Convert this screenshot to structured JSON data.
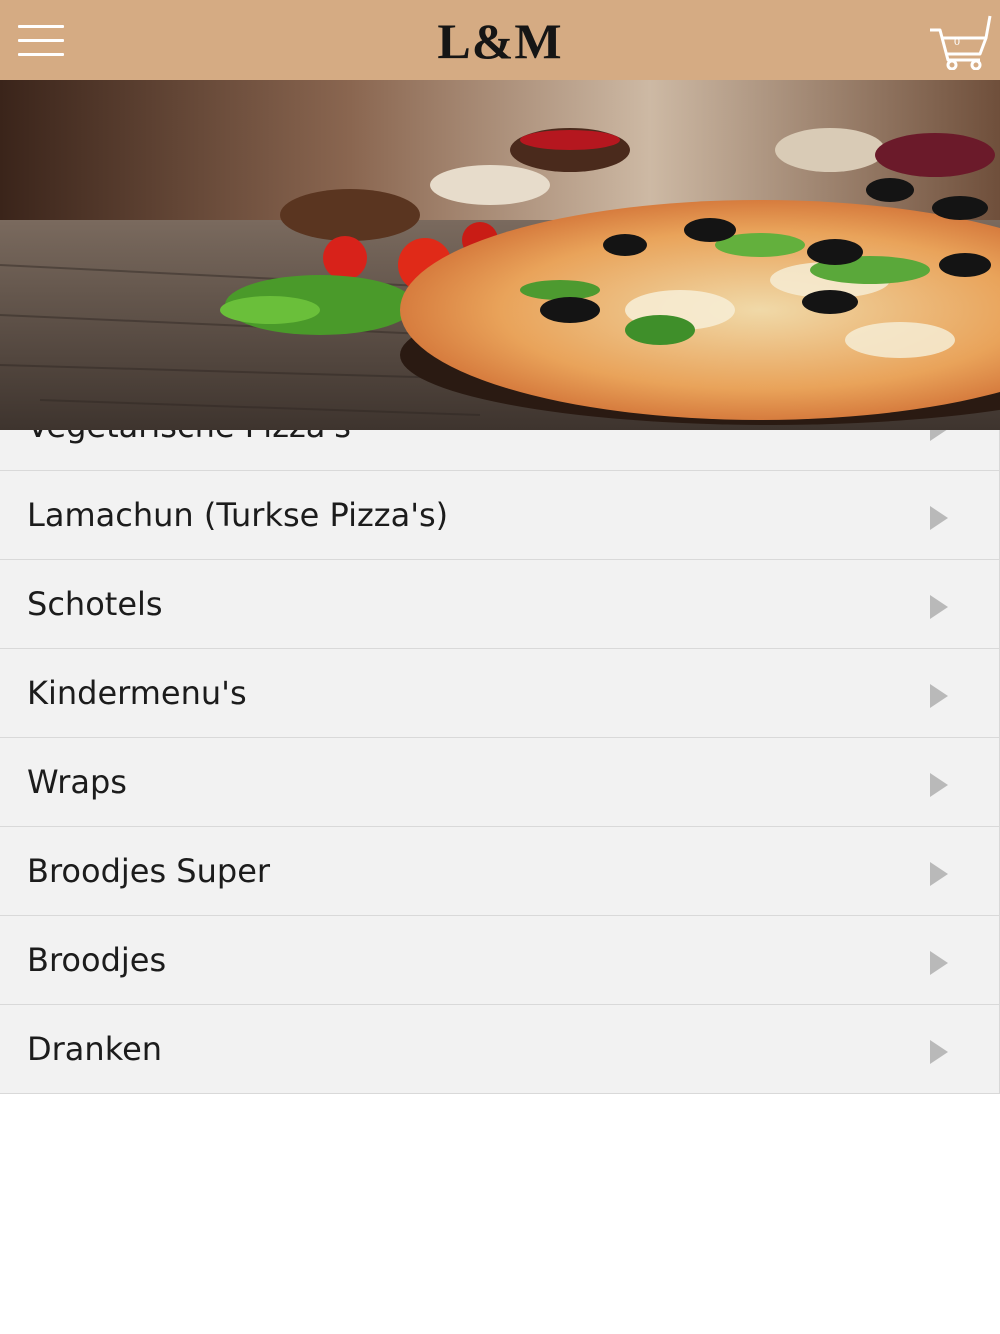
{
  "header": {
    "brand": "L&M",
    "cart_count": "0",
    "menu_icon": "hamburger-menu-icon",
    "cart_icon": "shopping-cart-icon"
  },
  "hero": {
    "image": "pizza-banner-image"
  },
  "colors": {
    "header_bg": "#d5ab83",
    "row_bg": "#f2f2f2",
    "arrow": "#b9b9b9"
  },
  "menu": {
    "items": [
      {
        "label": "Vegetarische Pizza's"
      },
      {
        "label": "Lamachun (Turkse Pizza's)"
      },
      {
        "label": "Schotels"
      },
      {
        "label": "Kindermenu's"
      },
      {
        "label": "Wraps"
      },
      {
        "label": "Broodjes Super"
      },
      {
        "label": "Broodjes"
      },
      {
        "label": "Dranken"
      }
    ]
  }
}
